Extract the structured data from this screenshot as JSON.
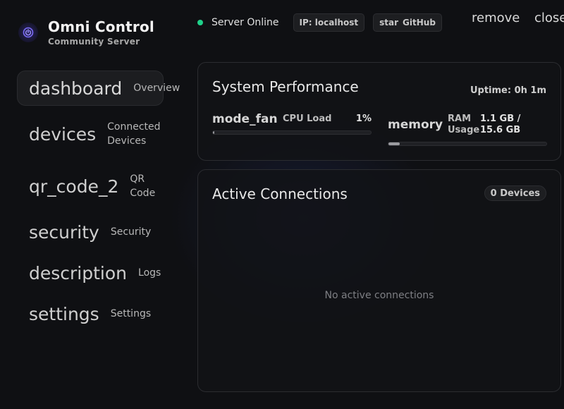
{
  "brand": {
    "title": "Omni Control",
    "subtitle": "Community Server",
    "logo_icon": "power-icon",
    "accent": "#6b5cf2"
  },
  "sidebar": {
    "items": [
      {
        "icon": "dashboard",
        "label": "Overview",
        "active": true
      },
      {
        "icon": "devices",
        "label": "Connected Devices",
        "active": false
      },
      {
        "icon": "qr_code_2",
        "label": "QR Code",
        "active": false
      },
      {
        "icon": "security",
        "label": "Security",
        "active": false
      },
      {
        "icon": "description",
        "label": "Logs",
        "active": false
      },
      {
        "icon": "settings",
        "label": "Settings",
        "active": false
      }
    ]
  },
  "topbar": {
    "status": "Server Online",
    "status_color": "#1fd18a",
    "ip": "IP: localhost",
    "github_icon": "star",
    "github_label": "GitHub",
    "minimize": "remove",
    "close": "close"
  },
  "performance": {
    "title": "System Performance",
    "uptime": "Uptime: 0h 1m",
    "cpu": {
      "icon": "mode_fan",
      "label": "CPU Load",
      "value": "1%",
      "fraction": 0.01
    },
    "ram": {
      "icon": "memory",
      "label": "RAM Usage",
      "value": "1.1 GB / 15.6 GB",
      "fraction": 0.07
    }
  },
  "connections": {
    "title": "Active Connections",
    "count": "0 Devices",
    "empty": "No active connections"
  }
}
